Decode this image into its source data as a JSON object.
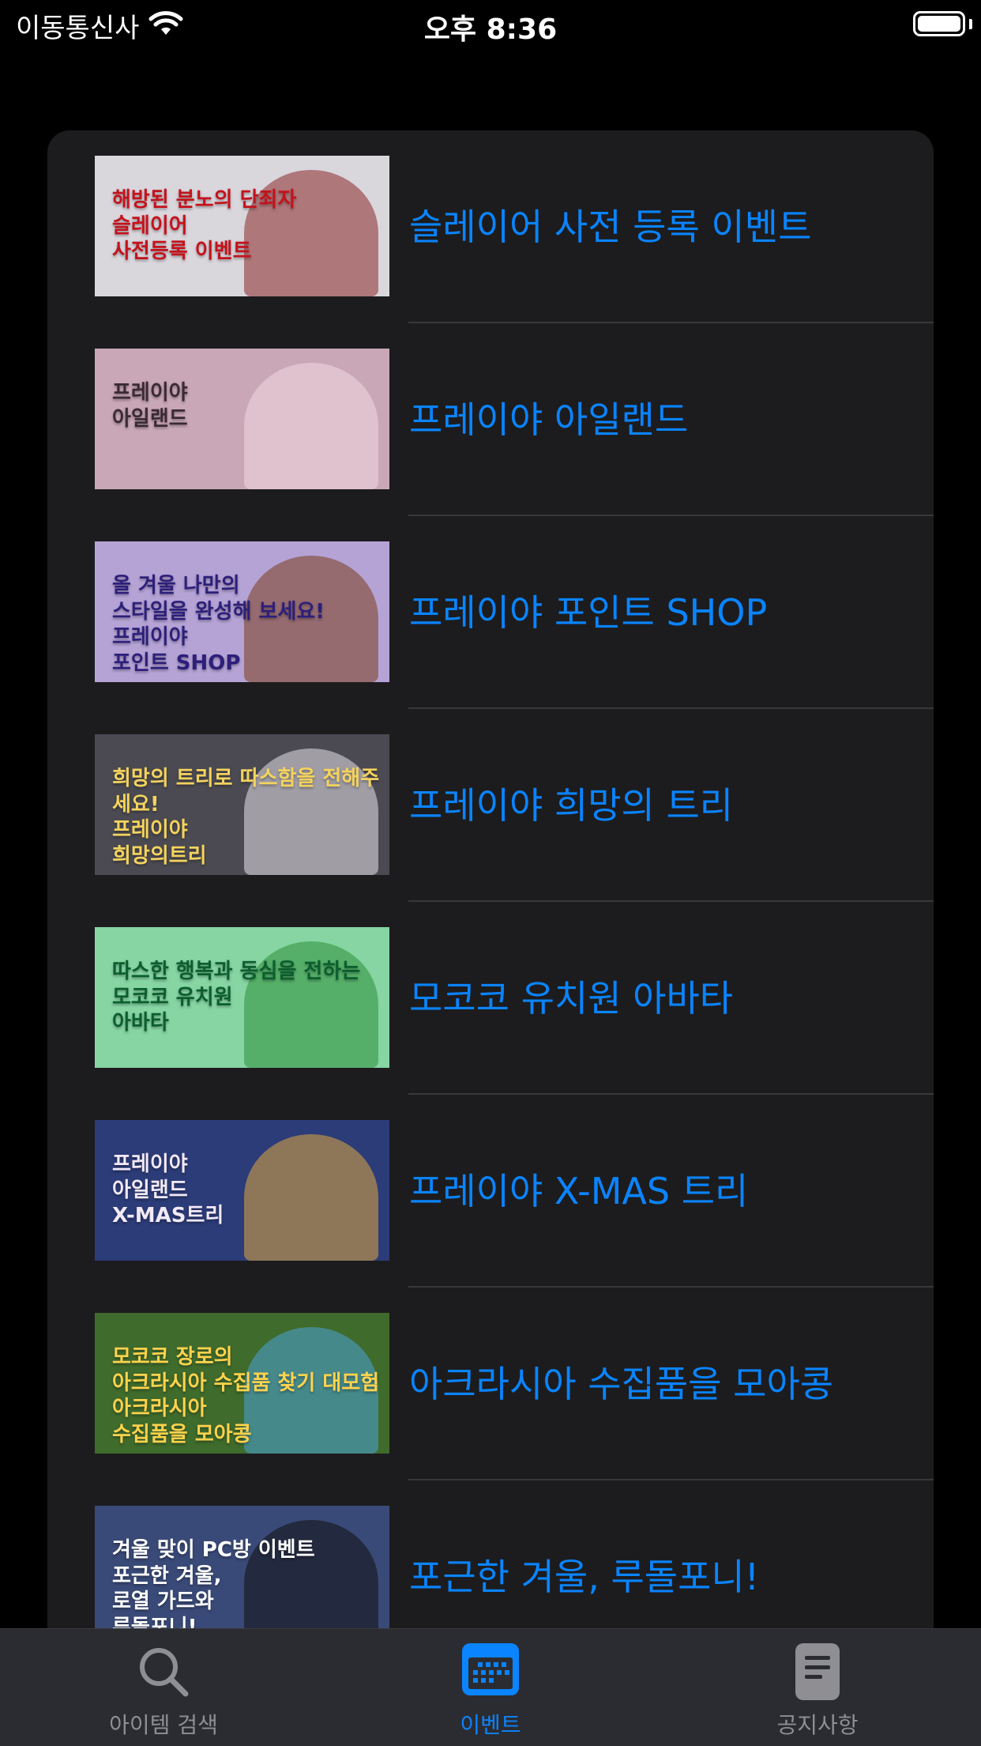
{
  "status_bar": {
    "carrier": "이동통신사",
    "time": "오후 8:36"
  },
  "events": [
    {
      "title": "슬레이어 사전 등록 이벤트",
      "banner_text": "해방된 분노의 단죄자\n슬레이어\n사전등록 이벤트",
      "bg": "#d9d6dc",
      "text_color": "#c4121c",
      "art_color": "#8b2a2a"
    },
    {
      "title": "프레이야 아일랜드",
      "banner_text": "프레이야\n아일랜드",
      "bg": "#c9a7b6",
      "text_color": "#3a2a34",
      "art_color": "#f1d9e2"
    },
    {
      "title": "프레이야 포인트 SHOP",
      "banner_text": "올 겨울 나만의\n스타일을 완성해 보세요!\n프레이야\n포인트 SHOP",
      "bg": "#b5a3d6",
      "text_color": "#2d1f7a",
      "art_color": "#7a3e1e"
    },
    {
      "title": "프레이야 희망의 트리",
      "banner_text": "희망의 트리로 따스함을 전해주세요!\n프레이야\n희망의트리",
      "bg": "#4b4a52",
      "text_color": "#f4d35e",
      "art_color": "#e8e2ea"
    },
    {
      "title": "모코코 유치원 아바타",
      "banner_text": "따스한 행복과 동심을 전하는\n모코코 유치원\n아바타",
      "bg": "#86d5a3",
      "text_color": "#0b5e2e",
      "art_color": "#2f8f3b"
    },
    {
      "title": "프레이야 X-MAS 트리",
      "banner_text": "프레이야\n아일랜드\nX-MAS트리",
      "bg": "#2b3c78",
      "text_color": "#f3e9f7",
      "art_color": "#e0a640"
    },
    {
      "title": "아크라시아 수집품을 모아콩",
      "banner_text": "모코코 장로의\n아크라시아 수집품 찾기 대모험\n아크라시아\n수집품을 모아콩",
      "bg": "#3f6b2c",
      "text_color": "#ffd34d",
      "art_color": "#4aa3d8"
    },
    {
      "title": "포근한 겨울, 루돌포니!",
      "banner_text": "겨울 맞이 PC방 이벤트\n포근한 겨울,\n로열 가드와\n루돌포니!",
      "bg": "#3a4a78",
      "text_color": "#ffffff",
      "art_color": "#111111"
    }
  ],
  "tab_bar": {
    "tabs": [
      {
        "label": "아이템 검색",
        "icon": "search-icon",
        "active": false
      },
      {
        "label": "이벤트",
        "icon": "calendar-icon",
        "active": true
      },
      {
        "label": "공지사항",
        "icon": "document-icon",
        "active": false
      }
    ],
    "active_color": "#0a84ff",
    "inactive_color": "#8e8e93"
  }
}
